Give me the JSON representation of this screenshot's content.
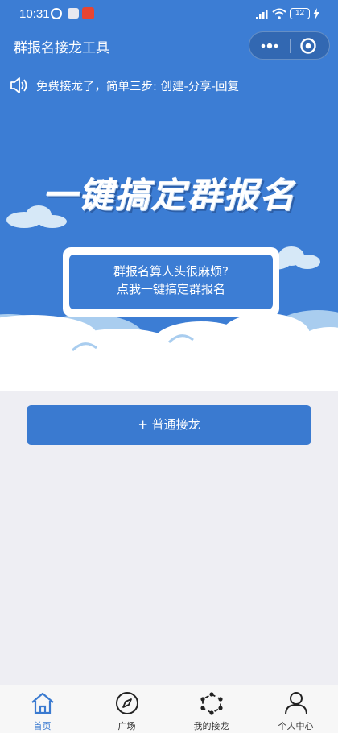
{
  "status_bar": {
    "time": "10:31",
    "battery": "12"
  },
  "nav": {
    "title": "群报名接龙工具"
  },
  "notice": {
    "text": "免费接龙了，简单三步: 创建-分享-回复"
  },
  "hero": {
    "headline": "一键搞定群报名",
    "cta_line1": "群报名算人头很麻烦?",
    "cta_line2": "点我一键搞定群报名"
  },
  "actions": {
    "normal_chain": "+ 普通接龙"
  },
  "tabs": [
    {
      "label": "首页",
      "icon": "home-icon",
      "active": true
    },
    {
      "label": "广场",
      "icon": "compass-icon",
      "active": false
    },
    {
      "label": "我的接龙",
      "icon": "network-icon",
      "active": false
    },
    {
      "label": "个人中心",
      "icon": "person-icon",
      "active": false
    }
  ],
  "colors": {
    "primary": "#3c7dd4",
    "button": "#3a7ad0",
    "background": "#eeeef3",
    "active_tab": "#3a7ad0"
  }
}
